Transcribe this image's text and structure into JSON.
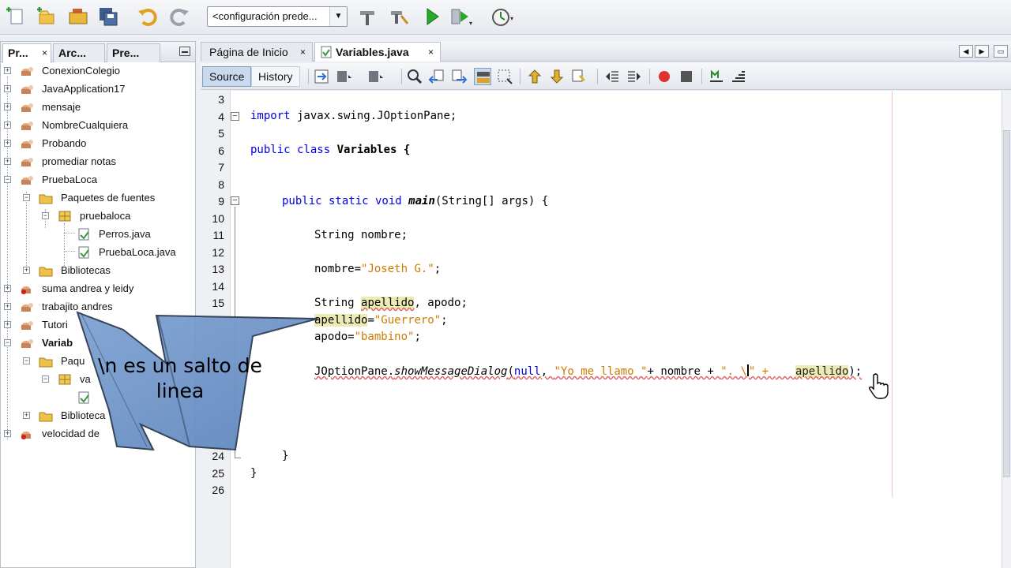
{
  "toolbar": {
    "config_value": "<configuración prede...",
    "icons": [
      "new-file-icon",
      "new-project-icon",
      "open-project-icon",
      "save-all-icon",
      "undo-icon",
      "redo-icon",
      "build-icon",
      "clean-build-icon",
      "run-icon",
      "debug-icon",
      "profile-icon"
    ]
  },
  "left_panel": {
    "tabs": [
      {
        "label": "Pr...",
        "close": "×"
      },
      {
        "label": "Arc..."
      },
      {
        "label": "Pre..."
      }
    ],
    "tree": [
      {
        "label": "ConexionColegio"
      },
      {
        "label": "JavaApplication17"
      },
      {
        "label": "mensaje"
      },
      {
        "label": "NombreCualquiera"
      },
      {
        "label": "Probando"
      },
      {
        "label": "promediar notas"
      },
      {
        "label": "PruebaLoca"
      },
      {
        "label": "Paquetes de fuentes"
      },
      {
        "label": "pruebaloca"
      },
      {
        "label": "Perros.java"
      },
      {
        "label": "PruebaLoca.java"
      },
      {
        "label": "Bibliotecas"
      },
      {
        "label": "suma andrea y leidy"
      },
      {
        "label": "trabajito andres"
      },
      {
        "label": "Tutori"
      },
      {
        "label": "Variab"
      },
      {
        "label": "Paqu"
      },
      {
        "label": "va"
      },
      {
        "label": "Biblioteca"
      },
      {
        "label": "velocidad de"
      }
    ]
  },
  "editor": {
    "tabs": [
      {
        "label": "Página de Inicio",
        "close": "×"
      },
      {
        "label": "Variables.java",
        "close": "×"
      }
    ],
    "view_buttons": {
      "source": "Source",
      "history": "History"
    },
    "line_numbers": [
      "3",
      "4",
      "5",
      "6",
      "7",
      "8",
      "9",
      "10",
      "11",
      "12",
      "13",
      "14",
      "15",
      "24",
      "25",
      "26"
    ],
    "code": {
      "l4_kw": "import",
      "l4_rest": " javax.swing.JOptionPane;",
      "l6_kw": "public class",
      "l6_rest": " Variables {",
      "l9_kw": "public static void",
      "l9_method": "main",
      "l9_rest": "(String[] args) {",
      "l11": "String nombre;",
      "l13_a": "nombre=",
      "l13_str": "\"Joseth G.\"",
      "l13_b": ";",
      "l15_a": "String ",
      "l15_var": "apellido",
      "l15_b": ", apodo;",
      "l16_var": "apellido",
      "l16_eq": "=",
      "l16_str": "\"Guerrero\"",
      "l16_b": ";",
      "l17_a": "apodo=",
      "l17_str": "\"bambino\"",
      "l17_b": ";",
      "l19_a": "JOptionPane.",
      "l19_method": "showMessageDialog",
      "l19_b": "(",
      "l19_null": "null",
      "l19_c": ", ",
      "l19_str1": "\"Yo me llamo \"",
      "l19_d": "+ nombre + ",
      "l19_str2": "\". \\",
      "l19_e": "\" + ",
      "l19_var": "apellido",
      "l19_f": ");",
      "l24": "}",
      "l25": "}"
    }
  },
  "overlay": {
    "line1": "\\n es un salto de",
    "line2": "linea"
  }
}
